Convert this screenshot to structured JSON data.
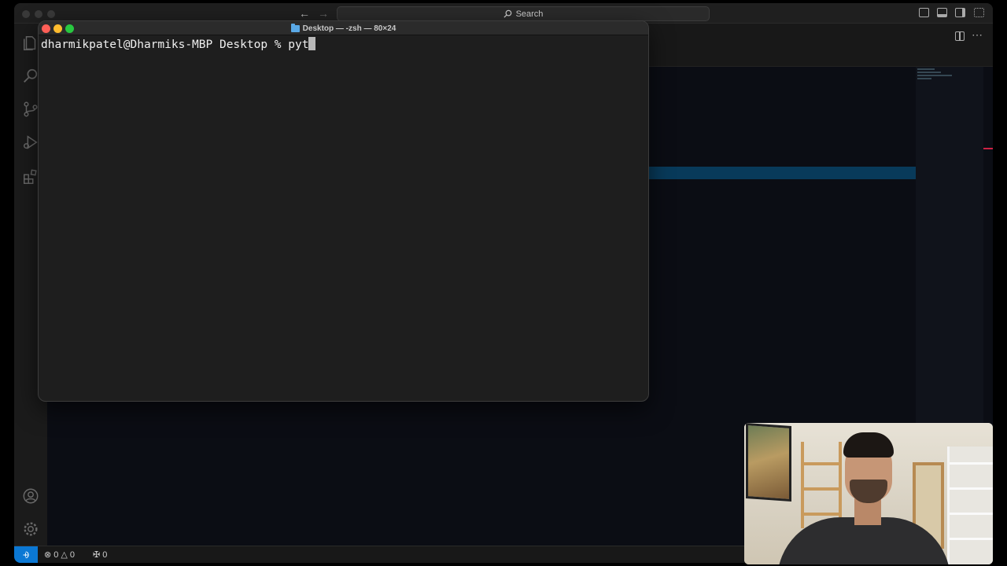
{
  "vscode": {
    "search_label": "Search",
    "status": {
      "errors": "0",
      "warnings": "0",
      "ports": "0"
    }
  },
  "terminal": {
    "title": "Desktop — -zsh — 80×24",
    "prompt": "dharmikpatel@Dharmiks-MBP Desktop % ",
    "input": "pyt"
  },
  "colors": {
    "remote_badge": "#0b78d4",
    "traffic_close": "#ff5f57",
    "traffic_minimize": "#febc2e",
    "traffic_maximize": "#28c840"
  },
  "icons": {
    "activity_bar": [
      "explorer-icon",
      "search-icon",
      "source-control-icon",
      "run-debug-icon",
      "extensions-icon",
      "account-icon",
      "settings-gear-icon"
    ]
  }
}
